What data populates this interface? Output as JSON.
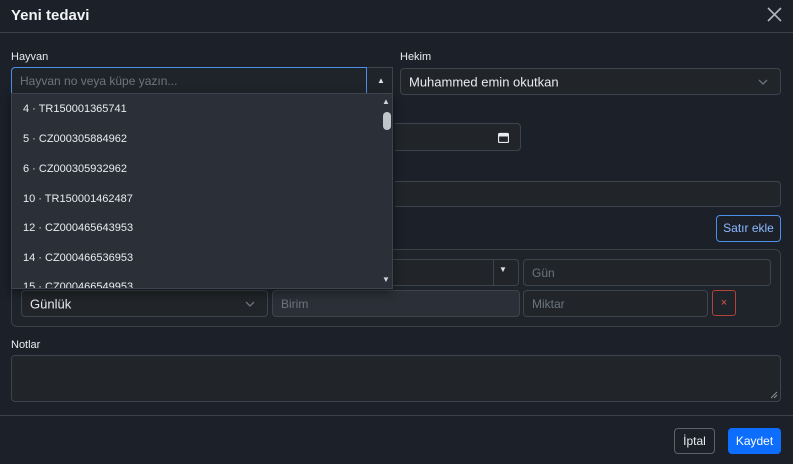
{
  "dialog": {
    "title": "Yeni tedavi"
  },
  "form": {
    "animal_label": "Hayvan",
    "animal_placeholder": "Hayvan no veya küpe yazın...",
    "vet_label": "Hekim",
    "vet_value": "Muhammed emin okutkan",
    "add_row_label": "Satır ekle",
    "notes_label": "Notlar"
  },
  "row": {
    "frequency_value": "Günlük",
    "day_placeholder": "Gün",
    "unit_placeholder": "Birim",
    "amount_placeholder": "Miktar",
    "remove_label": "×"
  },
  "dropdown": {
    "items": [
      "4 · TR150001365741",
      "5 · CZ000305884962",
      "6 · CZ000305932962",
      "10 · TR150001462487",
      "12 · CZ000465643953",
      "14 · CZ000466536953",
      "15 · CZ000466549953"
    ]
  },
  "footer": {
    "cancel_label": "İptal",
    "save_label": "Kaydet"
  },
  "icons": {
    "close": "close-icon",
    "calendar": "calendar-icon",
    "chevron": "chevron-down-icon",
    "caret_up": "caret-up-icon",
    "caret_down": "caret-down-icon"
  },
  "colors": {
    "accent": "#0d6efd",
    "danger": "#dc3545",
    "background": "#1b2029"
  }
}
